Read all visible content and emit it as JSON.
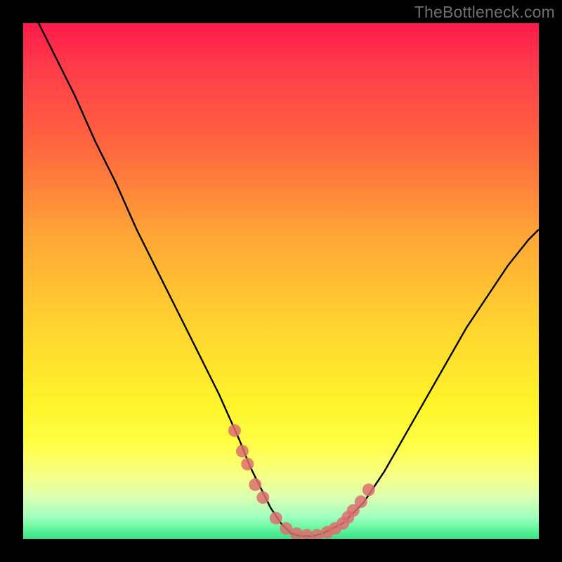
{
  "watermark": "TheBottleneck.com",
  "colors": {
    "frame": "#000000",
    "curve": "#000000",
    "dots": "#dd6f6f",
    "gradient_top": "#ff1a4a",
    "gradient_bottom": "#39e889"
  },
  "chart_data": {
    "type": "line",
    "title": "",
    "xlabel": "",
    "ylabel": "",
    "xlim": [
      0,
      100
    ],
    "ylim": [
      0,
      100
    ],
    "grid": false,
    "legend": false,
    "series": [
      {
        "name": "bottleneck-curve",
        "x": [
          3,
          6,
          10,
          14,
          18,
          22,
          26,
          30,
          34,
          38,
          42,
          44,
          46,
          48,
          50,
          52,
          54,
          56,
          58,
          60,
          62,
          66,
          70,
          74,
          78,
          82,
          86,
          90,
          94,
          98,
          100
        ],
        "y": [
          100,
          94,
          86,
          77,
          69,
          60,
          52,
          44,
          36,
          28,
          19,
          14,
          10,
          6,
          3,
          1,
          0.5,
          0.5,
          1,
          2,
          3,
          7,
          13,
          20,
          27,
          34,
          41,
          47,
          53,
          58,
          60
        ]
      }
    ],
    "dots": {
      "name": "highlight-dots",
      "x": [
        41,
        42.5,
        43.5,
        45,
        46.5,
        49,
        51,
        53,
        55,
        57,
        59,
        60.5,
        62,
        63,
        64,
        65.5,
        67
      ],
      "y": [
        21,
        17,
        14.5,
        10.5,
        8,
        4,
        2,
        1,
        0.7,
        0.7,
        1.3,
        2,
        3,
        4.2,
        5.5,
        7.2,
        9.5
      ]
    }
  }
}
